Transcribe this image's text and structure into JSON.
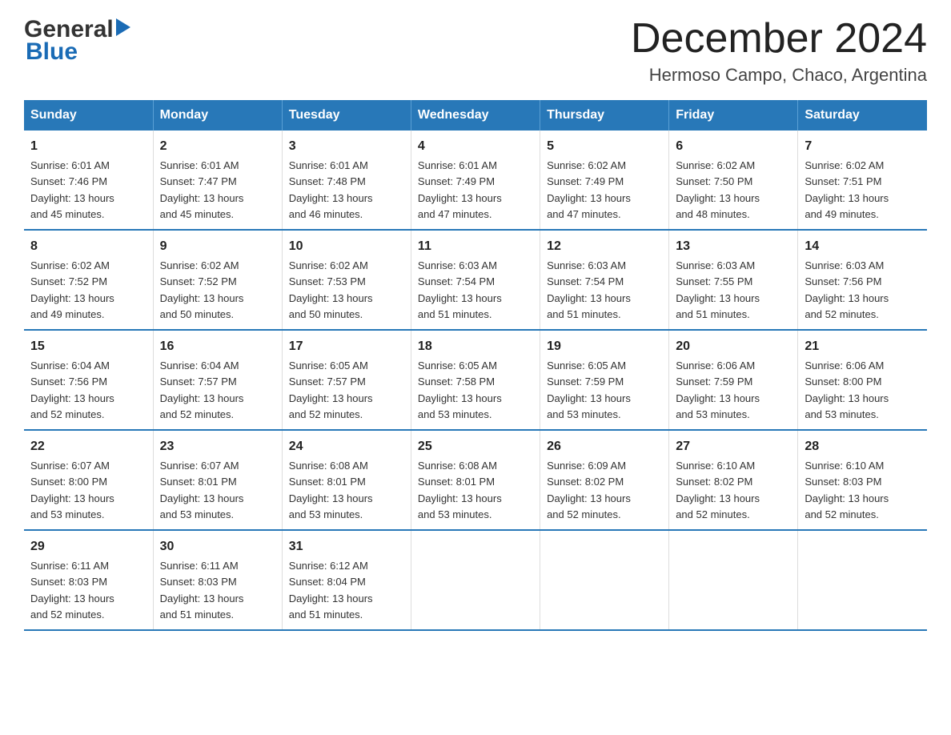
{
  "logo": {
    "text_general": "General",
    "triangle": "▶",
    "text_blue": "Blue"
  },
  "title": "December 2024",
  "subtitle": "Hermoso Campo, Chaco, Argentina",
  "header_color": "#2878b8",
  "days_of_week": [
    "Sunday",
    "Monday",
    "Tuesday",
    "Wednesday",
    "Thursday",
    "Friday",
    "Saturday"
  ],
  "weeks": [
    [
      {
        "day": "1",
        "sunrise": "6:01 AM",
        "sunset": "7:46 PM",
        "daylight": "13 hours and 45 minutes."
      },
      {
        "day": "2",
        "sunrise": "6:01 AM",
        "sunset": "7:47 PM",
        "daylight": "13 hours and 45 minutes."
      },
      {
        "day": "3",
        "sunrise": "6:01 AM",
        "sunset": "7:48 PM",
        "daylight": "13 hours and 46 minutes."
      },
      {
        "day": "4",
        "sunrise": "6:01 AM",
        "sunset": "7:49 PM",
        "daylight": "13 hours and 47 minutes."
      },
      {
        "day": "5",
        "sunrise": "6:02 AM",
        "sunset": "7:49 PM",
        "daylight": "13 hours and 47 minutes."
      },
      {
        "day": "6",
        "sunrise": "6:02 AM",
        "sunset": "7:50 PM",
        "daylight": "13 hours and 48 minutes."
      },
      {
        "day": "7",
        "sunrise": "6:02 AM",
        "sunset": "7:51 PM",
        "daylight": "13 hours and 49 minutes."
      }
    ],
    [
      {
        "day": "8",
        "sunrise": "6:02 AM",
        "sunset": "7:52 PM",
        "daylight": "13 hours and 49 minutes."
      },
      {
        "day": "9",
        "sunrise": "6:02 AM",
        "sunset": "7:52 PM",
        "daylight": "13 hours and 50 minutes."
      },
      {
        "day": "10",
        "sunrise": "6:02 AM",
        "sunset": "7:53 PM",
        "daylight": "13 hours and 50 minutes."
      },
      {
        "day": "11",
        "sunrise": "6:03 AM",
        "sunset": "7:54 PM",
        "daylight": "13 hours and 51 minutes."
      },
      {
        "day": "12",
        "sunrise": "6:03 AM",
        "sunset": "7:54 PM",
        "daylight": "13 hours and 51 minutes."
      },
      {
        "day": "13",
        "sunrise": "6:03 AM",
        "sunset": "7:55 PM",
        "daylight": "13 hours and 51 minutes."
      },
      {
        "day": "14",
        "sunrise": "6:03 AM",
        "sunset": "7:56 PM",
        "daylight": "13 hours and 52 minutes."
      }
    ],
    [
      {
        "day": "15",
        "sunrise": "6:04 AM",
        "sunset": "7:56 PM",
        "daylight": "13 hours and 52 minutes."
      },
      {
        "day": "16",
        "sunrise": "6:04 AM",
        "sunset": "7:57 PM",
        "daylight": "13 hours and 52 minutes."
      },
      {
        "day": "17",
        "sunrise": "6:05 AM",
        "sunset": "7:57 PM",
        "daylight": "13 hours and 52 minutes."
      },
      {
        "day": "18",
        "sunrise": "6:05 AM",
        "sunset": "7:58 PM",
        "daylight": "13 hours and 53 minutes."
      },
      {
        "day": "19",
        "sunrise": "6:05 AM",
        "sunset": "7:59 PM",
        "daylight": "13 hours and 53 minutes."
      },
      {
        "day": "20",
        "sunrise": "6:06 AM",
        "sunset": "7:59 PM",
        "daylight": "13 hours and 53 minutes."
      },
      {
        "day": "21",
        "sunrise": "6:06 AM",
        "sunset": "8:00 PM",
        "daylight": "13 hours and 53 minutes."
      }
    ],
    [
      {
        "day": "22",
        "sunrise": "6:07 AM",
        "sunset": "8:00 PM",
        "daylight": "13 hours and 53 minutes."
      },
      {
        "day": "23",
        "sunrise": "6:07 AM",
        "sunset": "8:01 PM",
        "daylight": "13 hours and 53 minutes."
      },
      {
        "day": "24",
        "sunrise": "6:08 AM",
        "sunset": "8:01 PM",
        "daylight": "13 hours and 53 minutes."
      },
      {
        "day": "25",
        "sunrise": "6:08 AM",
        "sunset": "8:01 PM",
        "daylight": "13 hours and 53 minutes."
      },
      {
        "day": "26",
        "sunrise": "6:09 AM",
        "sunset": "8:02 PM",
        "daylight": "13 hours and 52 minutes."
      },
      {
        "day": "27",
        "sunrise": "6:10 AM",
        "sunset": "8:02 PM",
        "daylight": "13 hours and 52 minutes."
      },
      {
        "day": "28",
        "sunrise": "6:10 AM",
        "sunset": "8:03 PM",
        "daylight": "13 hours and 52 minutes."
      }
    ],
    [
      {
        "day": "29",
        "sunrise": "6:11 AM",
        "sunset": "8:03 PM",
        "daylight": "13 hours and 52 minutes."
      },
      {
        "day": "30",
        "sunrise": "6:11 AM",
        "sunset": "8:03 PM",
        "daylight": "13 hours and 51 minutes."
      },
      {
        "day": "31",
        "sunrise": "6:12 AM",
        "sunset": "8:04 PM",
        "daylight": "13 hours and 51 minutes."
      },
      null,
      null,
      null,
      null
    ]
  ],
  "labels": {
    "sunrise": "Sunrise:",
    "sunset": "Sunset:",
    "daylight": "Daylight:"
  }
}
